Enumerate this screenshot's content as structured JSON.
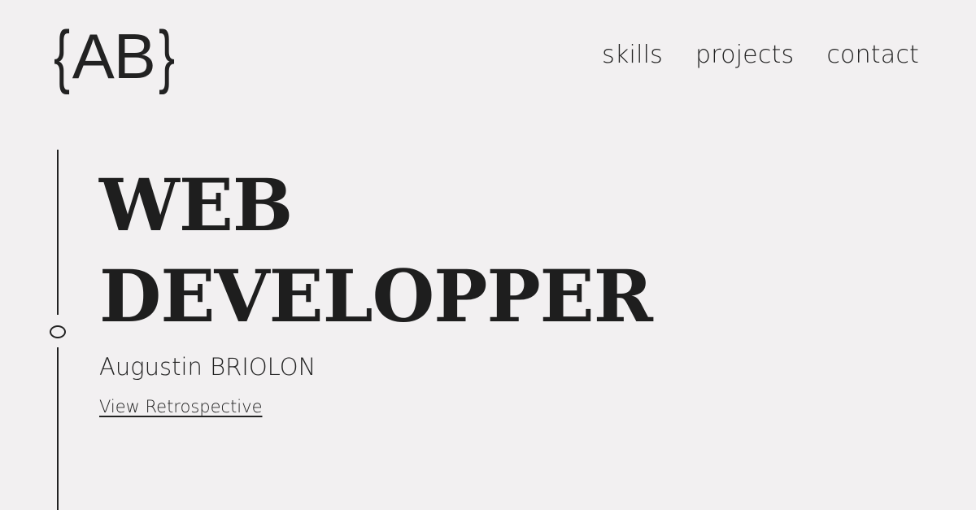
{
  "logo": {
    "open_brace": "{",
    "letters": "AB",
    "close_brace": "}"
  },
  "nav": {
    "items": [
      {
        "label": "skills"
      },
      {
        "label": "projects"
      },
      {
        "label": "contact"
      }
    ]
  },
  "hero": {
    "title_line1": "WEB",
    "title_line2": "DEVELOPPER",
    "name": "Augustin BRIOLON",
    "link_label": "View Retrospective"
  },
  "colors": {
    "background": "#f2f0f1",
    "text": "#1f1f1f"
  }
}
